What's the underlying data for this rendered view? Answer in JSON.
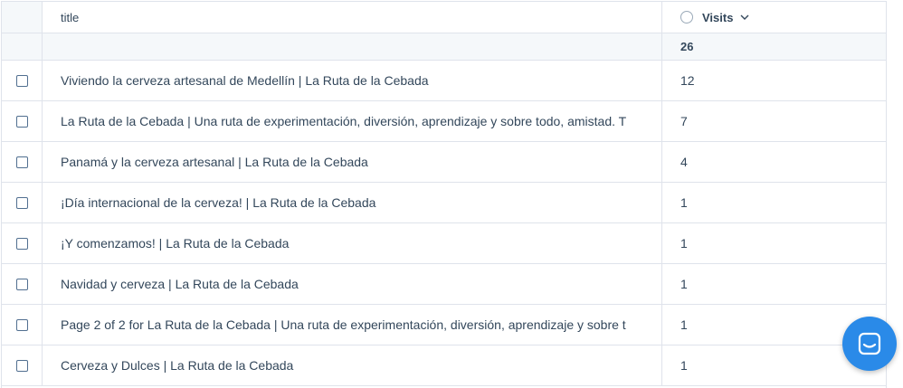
{
  "table": {
    "headers": {
      "title": "title",
      "visits": "Visits"
    },
    "totals": {
      "visits": "26"
    },
    "rows": [
      {
        "title": "Viviendo la cerveza artesanal de Medellín | La Ruta de la Cebada",
        "visits": "12"
      },
      {
        "title": "La Ruta de la Cebada | Una ruta de experimentación, diversión, aprendizaje y sobre todo, amistad. T",
        "visits": "7"
      },
      {
        "title": "Panamá y la cerveza artesanal | La Ruta de la Cebada",
        "visits": "4"
      },
      {
        "title": "¡Día internacional de la cerveza! | La Ruta de la Cebada",
        "visits": "1"
      },
      {
        "title": "¡Y comenzamos! | La Ruta de la Cebada",
        "visits": "1"
      },
      {
        "title": "Navidad y cerveza | La Ruta de la Cebada",
        "visits": "1"
      },
      {
        "title": "Page 2 of 2 for La Ruta de la Cebada | Una ruta de experimentación, diversión, aprendizaje y sobre t",
        "visits": "1"
      },
      {
        "title": "Cerveza y Dulces | La Ruta de la Cebada",
        "visits": "1"
      }
    ]
  },
  "icons": {
    "sort_icon": "chevron-down-icon",
    "column_toggle": "radio-circle-icon",
    "chat": "chat-launcher-icon"
  },
  "colors": {
    "accent": "#2a8ae8",
    "text": "#33475b",
    "border": "#dfe3eb",
    "header_bg": "#f5f8fa"
  }
}
